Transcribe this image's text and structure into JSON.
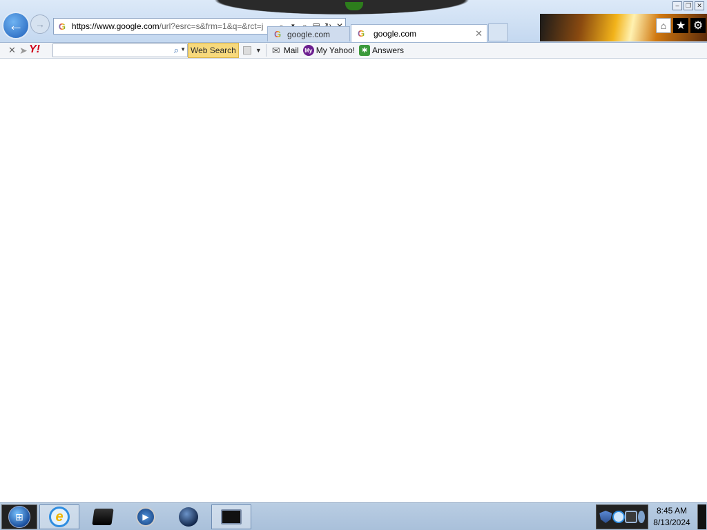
{
  "browser": {
    "address": {
      "url_host": "https://www.google.com",
      "url_rest": "/url?esrc=s&frm=1&q=&rct=j"
    },
    "tabs": [
      {
        "label": "google.com",
        "active": false
      },
      {
        "label": "google.com",
        "active": true
      }
    ],
    "icons": {
      "back": "back-arrow-icon",
      "forward": "forward-arrow-icon",
      "search": "search-icon",
      "lock": "lock-icon",
      "compat": "compatibility-view-icon",
      "refresh": "refresh-icon",
      "stop": "stop-icon",
      "home": "home-icon",
      "favorites": "star-icon",
      "tools": "gear-icon"
    }
  },
  "yahoo_toolbar": {
    "search_value": "",
    "web_search_label": "Web Search",
    "links": [
      {
        "label": "Mail",
        "icon": "mail-icon"
      },
      {
        "label": "My Yahoo!",
        "icon": "my-yahoo-icon",
        "badge": "My"
      },
      {
        "label": "Answers",
        "icon": "answers-icon"
      }
    ]
  },
  "taskbar": {
    "items": [
      {
        "name": "internet-explorer",
        "active": true
      },
      {
        "name": "file-explorer",
        "active": false
      },
      {
        "name": "media-player",
        "active": false
      },
      {
        "name": "globe-app",
        "active": false
      },
      {
        "name": "window-app",
        "active": false
      }
    ],
    "clock": {
      "time": "8:45 AM",
      "date": "8/13/2024"
    }
  },
  "colors": {
    "chrome_bg": "#c4d8f0",
    "web_search_bg": "#f7d97c",
    "yahoo_red": "#d0021b",
    "taskbar_bg": "#a9c0da"
  }
}
